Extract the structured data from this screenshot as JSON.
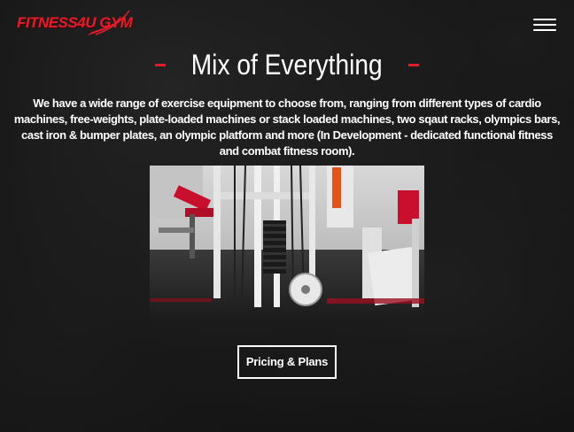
{
  "header": {
    "logo_text": "FITNESS4U GYM",
    "menu_icon": "hamburger-menu-icon"
  },
  "section": {
    "title": "Mix of Everything",
    "description": "We have a wide range of exercise equipment to choose from, ranging from different types of cardio machines, free-weights, plate-loaded machines or stack loaded machines, two sqaut racks, olympics bars, cast iron & bumper plates, an olympic platform and more (In Development - dedicated functional fitness and combat fitness room).",
    "cta_label": "Pricing & Plans"
  },
  "colors": {
    "accent": "#e21d2b",
    "background": "#121212",
    "text": "#ffffff"
  }
}
